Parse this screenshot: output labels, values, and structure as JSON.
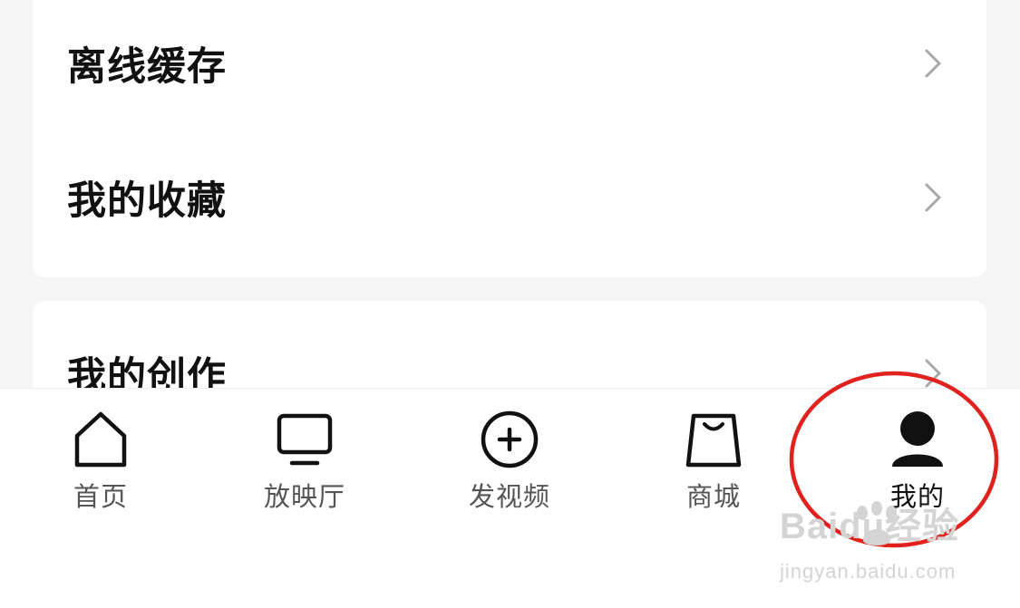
{
  "menu": {
    "group1": [
      {
        "label": "离线缓存"
      },
      {
        "label": "我的收藏"
      }
    ],
    "group2": [
      {
        "label": "我的创作"
      }
    ]
  },
  "tabbar": {
    "tabs": [
      {
        "label": "首页",
        "icon": "home-icon"
      },
      {
        "label": "放映厅",
        "icon": "tv-icon"
      },
      {
        "label": "发视频",
        "icon": "add-circle-icon"
      },
      {
        "label": "商城",
        "icon": "shopping-bag-icon"
      },
      {
        "label": "我的",
        "icon": "user-icon",
        "active": true
      }
    ]
  },
  "annotation": {
    "color": "#e0211d"
  },
  "watermark": {
    "logo": "Baidu经验",
    "url": "jingyan.baidu.com"
  }
}
